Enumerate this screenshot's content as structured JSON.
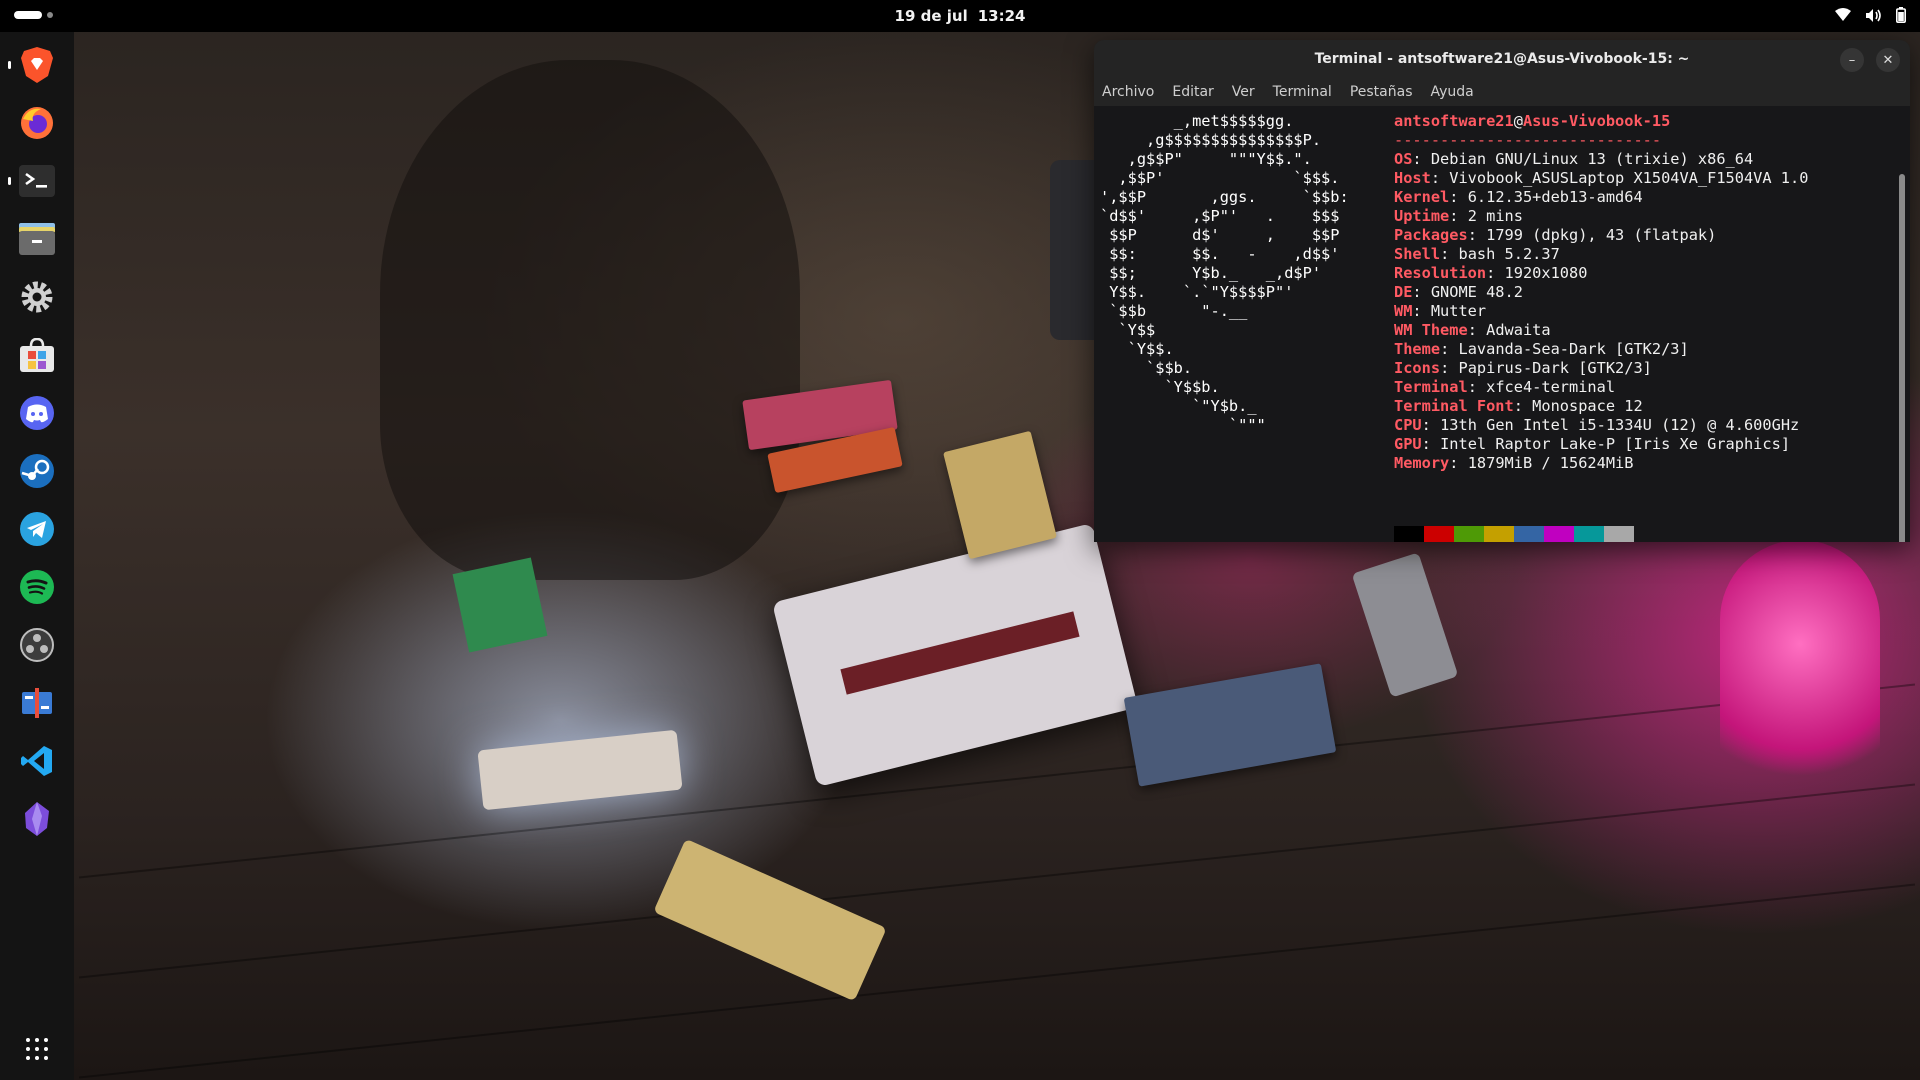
{
  "topbar": {
    "date": "19 de jul",
    "time": "13:24",
    "tray_icons": [
      "wifi-icon",
      "volume-icon",
      "battery-icon"
    ]
  },
  "dock": {
    "apps": [
      {
        "name": "Brave",
        "icon": "brave-icon",
        "color": "#fb542b",
        "running": true
      },
      {
        "name": "Firefox",
        "icon": "firefox-icon",
        "color": "#ff7139",
        "running": false
      },
      {
        "name": "Terminal",
        "icon": "terminal-icon",
        "color": "#2e2e2e",
        "running": true
      },
      {
        "name": "Files",
        "icon": "files-icon",
        "color": "#6b6b6b",
        "running": false
      },
      {
        "name": "Settings",
        "icon": "settings-icon",
        "color": "#d0d0d0",
        "running": false
      },
      {
        "name": "Software",
        "icon": "software-store-icon",
        "color": "#e9e9e9",
        "running": false
      },
      {
        "name": "Discord",
        "icon": "discord-icon",
        "color": "#5865f2",
        "running": false
      },
      {
        "name": "Steam",
        "icon": "steam-icon",
        "color": "#1b6fbf",
        "running": false
      },
      {
        "name": "Telegram",
        "icon": "telegram-icon",
        "color": "#2aa3e0",
        "running": false
      },
      {
        "name": "Spotify",
        "icon": "spotify-icon",
        "color": "#1db954",
        "running": false
      },
      {
        "name": "OBS",
        "icon": "obs-icon",
        "color": "#3c3c3c",
        "running": false
      },
      {
        "name": "Kdenlive",
        "icon": "video-editor-icon",
        "color": "#3a7bd5",
        "running": false
      },
      {
        "name": "VS Code",
        "icon": "vscode-icon",
        "color": "#23a9f2",
        "running": false
      },
      {
        "name": "Obsidian",
        "icon": "obsidian-icon",
        "color": "#7c4ddb",
        "running": false
      }
    ],
    "show_apps_icon": "app-grid-icon"
  },
  "terminal": {
    "title": "Terminal - antsoftware21@Asus-Vivobook-15: ~",
    "menu": [
      "Archivo",
      "Editar",
      "Ver",
      "Terminal",
      "Pestañas",
      "Ayuda"
    ],
    "minimize_label": "–",
    "close_label": "✕",
    "ascii_logo": "        _,met$$$$$gg.\n     ,g$$$$$$$$$$$$$$$P.\n   ,g$$P\"     \"\"\"Y$$.\".\n  ,$$P'              `$$$.\n',$$P       ,ggs.     `$$b:\n`d$$'     ,$P\"'   .    $$$\n $$P      d$'     ,    $$P\n $$:      $$.   -    ,d$$'\n $$;      Y$b._   _,d$P'\n Y$$.    `.`\"Y$$$$P\"'\n `$$b      \"-.__\n  `Y$$\n   `Y$$.\n     `$$b.\n       `Y$$b.\n          `\"Y$b._\n              `\"\"\"",
    "user": "antsoftware21",
    "at": "@",
    "host": "Asus-Vivobook-15",
    "separator": "-----------------------------",
    "info": [
      {
        "key": "OS",
        "value": "Debian GNU/Linux 13 (trixie) x86_64"
      },
      {
        "key": "Host",
        "value": "Vivobook_ASUSLaptop X1504VA_F1504VA 1.0"
      },
      {
        "key": "Kernel",
        "value": "6.12.35+deb13-amd64"
      },
      {
        "key": "Uptime",
        "value": "2 mins"
      },
      {
        "key": "Packages",
        "value": "1799 (dpkg), 43 (flatpak)"
      },
      {
        "key": "Shell",
        "value": "bash 5.2.37"
      },
      {
        "key": "Resolution",
        "value": "1920x1080"
      },
      {
        "key": "DE",
        "value": "GNOME 48.2"
      },
      {
        "key": "WM",
        "value": "Mutter"
      },
      {
        "key": "WM Theme",
        "value": "Adwaita"
      },
      {
        "key": "Theme",
        "value": "Lavanda-Sea-Dark [GTK2/3]"
      },
      {
        "key": "Icons",
        "value": "Papirus-Dark [GTK2/3]"
      },
      {
        "key": "Terminal",
        "value": "xfce4-terminal"
      },
      {
        "key": "Terminal Font",
        "value": "Monospace 12"
      },
      {
        "key": "CPU",
        "value": "13th Gen Intel i5-1334U (12) @ 4.600GHz"
      },
      {
        "key": "GPU",
        "value": "Intel Raptor Lake-P [Iris Xe Graphics]"
      },
      {
        "key": "Memory",
        "value": "1879MiB / 15624MiB"
      }
    ],
    "palette_top": [
      "#000000",
      "#cc0000",
      "#4e9a06",
      "#c4a000",
      "#3465a4",
      "#c000c0",
      "#06989a",
      "#a8a8a8"
    ],
    "palette_bottom": [
      "#555555",
      "#ef2929",
      "#33e033",
      "#fce94f",
      "#5c5cff",
      "#ff40ff",
      "#34e2e2",
      "#ffffff"
    ]
  },
  "colors": {
    "accent_red": "#ff5a63",
    "topbar_bg": "#000000",
    "dock_bg": "#141414"
  }
}
